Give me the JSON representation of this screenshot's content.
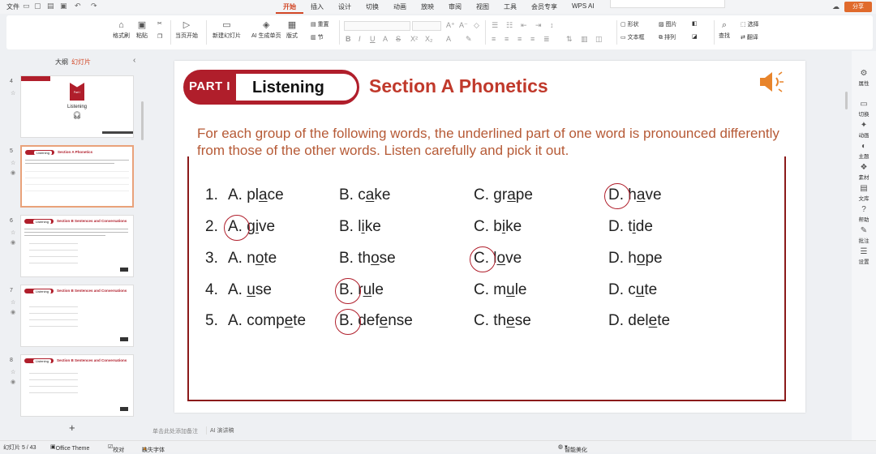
{
  "titlebar": {
    "file_menu": "文件",
    "tabs": [
      "开始",
      "插入",
      "设计",
      "切换",
      "动画",
      "放映",
      "审阅",
      "视图",
      "工具",
      "会员专享",
      "WPS AI"
    ],
    "active_tab": "开始",
    "share": "分享"
  },
  "ribbon": {
    "format_painter": "格式刷",
    "paste": "粘贴",
    "play_from_current": "当页开始",
    "new_slide": "新建幻灯片",
    "ai_generate": "AI 生成单页",
    "layout": "版式",
    "section": "节",
    "reset": "重置",
    "shape": "形状",
    "picture": "图片",
    "textbox": "文本框",
    "arrange": "排列",
    "find": "查找",
    "select": "选择",
    "translate": "翻译"
  },
  "leftpanel": {
    "tab_outline": "大纲",
    "tab_slides": "幻灯片",
    "thumbs": [
      {
        "num": "4",
        "title": "Listening",
        "badge": "Part I"
      },
      {
        "num": "5",
        "head": "Listening",
        "title": "Section A  Phonetics"
      },
      {
        "num": "6",
        "head": "Listening",
        "title": "Section B  Sentences and Conversations"
      },
      {
        "num": "7",
        "head": "Listening",
        "title": "Section B  Sentences and Conversations"
      },
      {
        "num": "8",
        "head": "Listening",
        "title": "Section B  Sentences and Conversations"
      }
    ],
    "add": "+"
  },
  "slide": {
    "part_label": "PART I",
    "part_title": "Listening",
    "section_title": "Section A  Phonetics",
    "instruction": "For each group of the following words, the underlined part of one word is pronounced differently from those of the other words. Listen carefully and pick it out.",
    "questions": [
      {
        "num": "1.",
        "options": [
          {
            "letter": "A.",
            "pre": "pl",
            "u": "a",
            "post": "ce",
            "circled": false
          },
          {
            "letter": "B.",
            "pre": "c",
            "u": "a",
            "post": "ke",
            "circled": false
          },
          {
            "letter": "C.",
            "pre": "gr",
            "u": "a",
            "post": "pe",
            "circled": false
          },
          {
            "letter": "D.",
            "pre": "h",
            "u": "a",
            "post": "ve",
            "circled": true
          }
        ]
      },
      {
        "num": "2.",
        "options": [
          {
            "letter": "A.",
            "pre": "g",
            "u": "i",
            "post": "ve",
            "circled": true
          },
          {
            "letter": "B.",
            "pre": "l",
            "u": "i",
            "post": "ke",
            "circled": false
          },
          {
            "letter": "C.",
            "pre": "b",
            "u": "i",
            "post": "ke",
            "circled": false
          },
          {
            "letter": "D.",
            "pre": "t",
            "u": "i",
            "post": "de",
            "circled": false
          }
        ]
      },
      {
        "num": "3.",
        "options": [
          {
            "letter": "A.",
            "pre": "n",
            "u": "o",
            "post": "te",
            "circled": false
          },
          {
            "letter": "B.",
            "pre": "th",
            "u": "o",
            "post": "se",
            "circled": false
          },
          {
            "letter": "C.",
            "pre": "l",
            "u": "o",
            "post": "ve",
            "circled": true
          },
          {
            "letter": "D.",
            "pre": "h",
            "u": "o",
            "post": "pe",
            "circled": false
          }
        ]
      },
      {
        "num": "4.",
        "options": [
          {
            "letter": "A.",
            "pre": "",
            "u": "u",
            "post": "se",
            "circled": false
          },
          {
            "letter": "B.",
            "pre": "r",
            "u": "u",
            "post": "le",
            "circled": true
          },
          {
            "letter": "C.",
            "pre": "m",
            "u": "u",
            "post": "le",
            "circled": false
          },
          {
            "letter": "D.",
            "pre": "c",
            "u": "u",
            "post": "te",
            "circled": false
          }
        ]
      },
      {
        "num": "5.",
        "options": [
          {
            "letter": "A.",
            "pre": "comp",
            "u": "e",
            "post": "te",
            "circled": false
          },
          {
            "letter": "B.",
            "pre": "def",
            "u": "e",
            "post": "nse",
            "circled": true
          },
          {
            "letter": "C.",
            "pre": "th",
            "u": "e",
            "post": "se",
            "circled": false
          },
          {
            "letter": "D.",
            "pre": "del",
            "u": "e",
            "post": "te",
            "circled": false
          }
        ]
      }
    ]
  },
  "rightbar": [
    "属性",
    "切换",
    "动画",
    "主题",
    "素材",
    "文库",
    "帮助",
    "批注",
    "设置"
  ],
  "notes": {
    "placeholder": "单击此处添加备注",
    "ai": "AI 演讲稿"
  },
  "status": {
    "slide_count": "幻灯片 5 / 43",
    "theme": "Office Theme",
    "proof": "校对",
    "missing_font": "缺失字体",
    "smart_beautify": "智能美化"
  }
}
